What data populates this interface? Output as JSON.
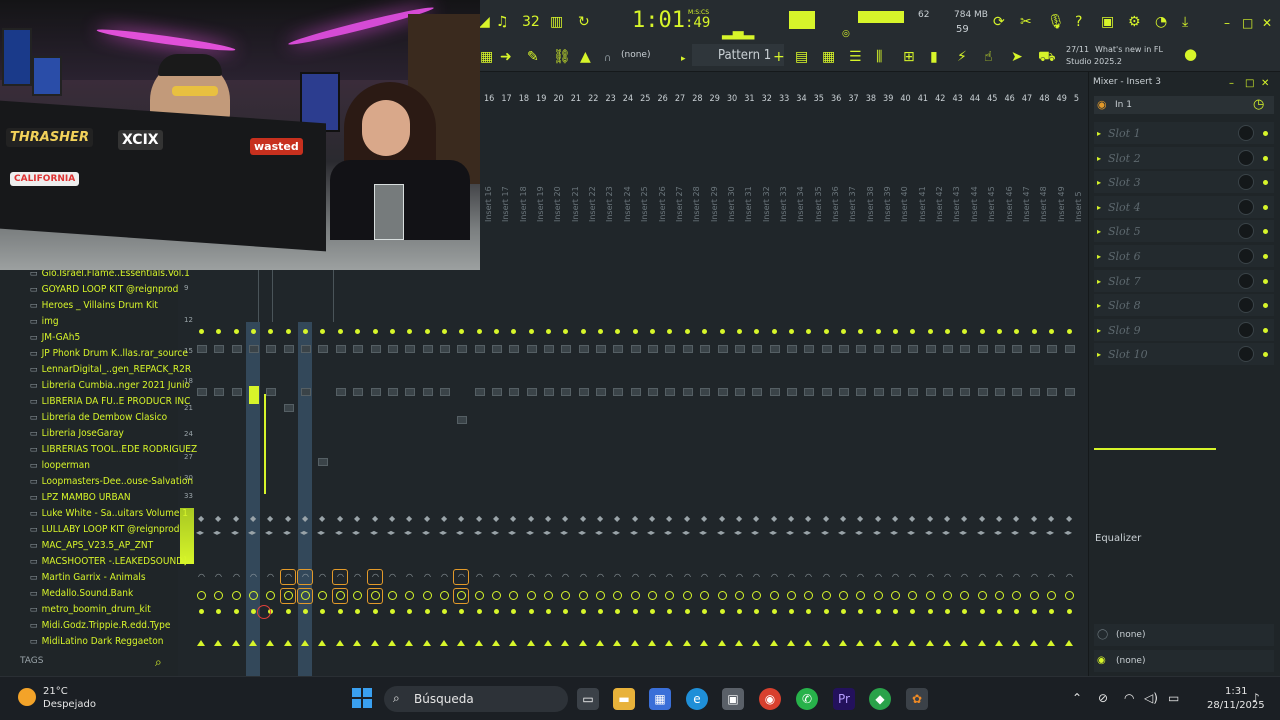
{
  "toolbar": {
    "time_main": "1:01",
    "time_sub": ":49",
    "time_unit": "M:S:CS",
    "cpu": "62",
    "memory": "784 MB",
    "polyphony": "59",
    "pattern": "Pattern 1",
    "snap": "(none)",
    "news_date": "27/11",
    "news_title": "What's new in FL",
    "news_subtitle": "Studio 2025.2"
  },
  "mixer": {
    "channel_numbers": [
      "16",
      "17",
      "18",
      "19",
      "20",
      "21",
      "22",
      "23",
      "24",
      "25",
      "26",
      "27",
      "28",
      "29",
      "30",
      "31",
      "32",
      "33",
      "34",
      "35",
      "36",
      "37",
      "38",
      "39",
      "40",
      "41",
      "42",
      "43",
      "44",
      "45",
      "46",
      "47",
      "48",
      "49",
      "5"
    ],
    "insert_names": [
      "Insert 16",
      "Insert 17",
      "Insert 18",
      "Insert 19",
      "Insert 20",
      "Insert 21",
      "Insert 22",
      "Insert 23",
      "Insert 24",
      "Insert 25",
      "Insert 26",
      "Insert 27",
      "Insert 28",
      "Insert 29",
      "Insert 30",
      "Insert 31",
      "Insert 32",
      "Insert 33",
      "Insert 34",
      "Insert 35",
      "Insert 36",
      "Insert 37",
      "Insert 38",
      "Insert 39",
      "Insert 40",
      "Insert 41",
      "Insert 42",
      "Insert 43",
      "Insert 44",
      "Insert 45",
      "Insert 46",
      "Insert 47",
      "Insert 48",
      "Insert 49",
      "Insert 5"
    ],
    "scale_labels": [
      "9",
      "12",
      "15",
      "18",
      "21",
      "24",
      "27",
      "30",
      "33"
    ]
  },
  "browser": {
    "items": [
      "Gio.Israel.Flame..Essentials.Vol.1",
      "GOYARD LOOP KIT @reignprod",
      "Heroes _ Villains Drum Kit",
      "img",
      "JM-GAh5",
      "JP Phonk Drum K..llas.rar_source",
      "LennarDigital_..gen_REPACK_R2R",
      "Libreria Cumbia..nger 2021 Junio",
      "LIBRERIA DA FU..E PRODUCR INC",
      "Libreria de Dembow Clasico",
      "Libreria JoseGaray",
      "LIBRERIAS TOOL..EDE RODRIGUEZ",
      "looperman",
      "Loopmasters-Dee..ouse-Salvation",
      "LPZ MAMBO URBAN",
      "Luke White - Sa..uitars Volume 1",
      "LULLABY LOOP KIT @reignprod",
      "MAC_APS_V23.5_AP_ZNT",
      "MACSHOOTER -.LEAKEDSOUND]",
      "Martin Garrix - Animals",
      "Medallo.Sound.Bank",
      "metro_boomin_drum_kit",
      "Midi.Godz.Trippie.R.edd.Type",
      "MidiLatino Dark Reggaeton"
    ],
    "tags_label": "TAGS"
  },
  "webcam": {
    "stickers": [
      "THRASHER",
      "XCIX",
      "wasted",
      "CALIFORNIA"
    ]
  },
  "insert_panel": {
    "title": "Mixer - Insert 3",
    "input": "In 1",
    "slots": [
      "Slot 1",
      "Slot 2",
      "Slot 3",
      "Slot 4",
      "Slot 5",
      "Slot 6",
      "Slot 7",
      "Slot 8",
      "Slot 9",
      "Slot 10"
    ],
    "eq_label": "Equalizer",
    "route_in": "(none)",
    "route_out": "(none)"
  },
  "taskbar": {
    "temperature": "21°C",
    "weather": "Despejado",
    "search_placeholder": "Búsqueda",
    "time": "1:31",
    "date": "28/11/2025"
  },
  "colors": {
    "accent": "#d7f52a",
    "background": "#1d2226",
    "selected_strip": "#33485a"
  }
}
